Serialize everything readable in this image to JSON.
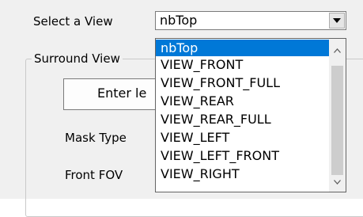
{
  "view_selector": {
    "label": "Select a View",
    "selected_value": "nbTop",
    "options": [
      "nbTop",
      "VIEW_FRONT",
      "VIEW_FRONT_FULL",
      "VIEW_REAR",
      "VIEW_REAR_FULL",
      "VIEW_LEFT",
      "VIEW_LEFT_FRONT",
      "VIEW_RIGHT"
    ],
    "highlight_color": "#0078d7"
  },
  "surround_group": {
    "title": "Surround View",
    "enter_button_label": "Enter le",
    "mask_type_label": "Mask Type",
    "front_fov_label": "Front FOV"
  },
  "icons": {
    "combo_arrow": "chevron-down-icon",
    "scroll_up": "chevron-up-icon",
    "scroll_down": "chevron-down-icon"
  }
}
